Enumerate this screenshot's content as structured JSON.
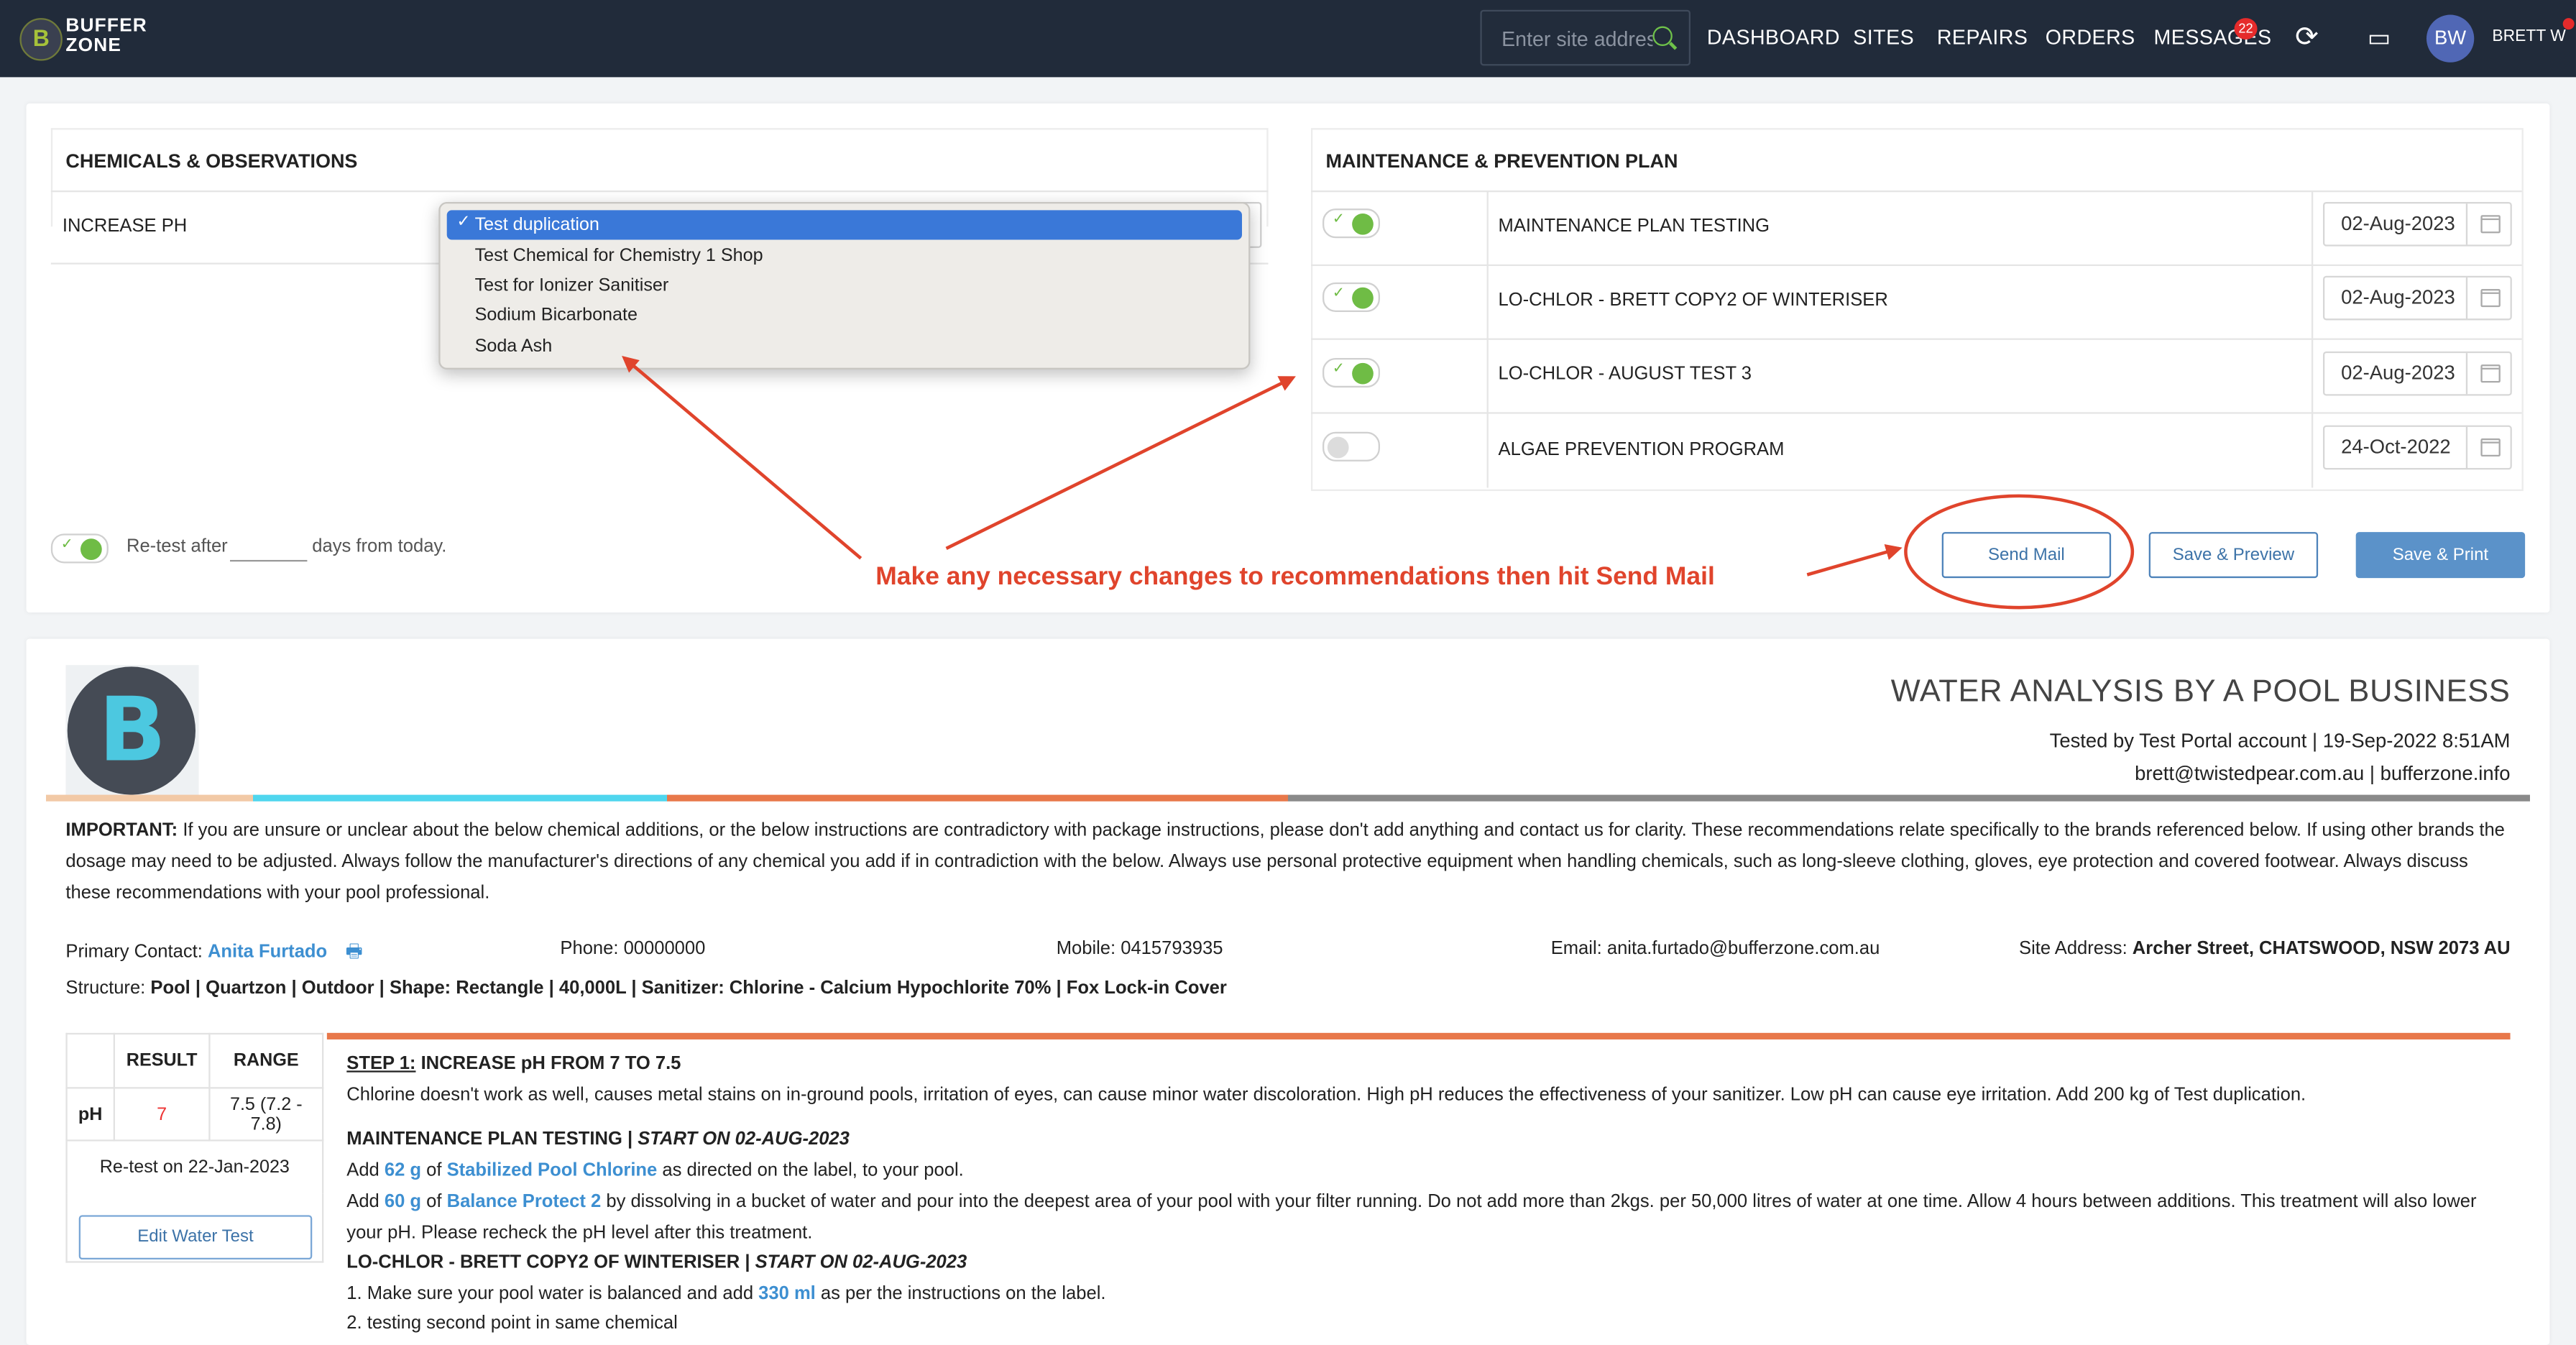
{
  "nav": {
    "logo_line1": "BUFFER",
    "logo_line2": "ZONE",
    "logo_glyph": "B",
    "search_placeholder": "Enter site address",
    "links": [
      "DASHBOARD",
      "SITES",
      "REPAIRS",
      "ORDERS",
      "MESSAGES"
    ],
    "messages_badge": "22",
    "avatar_initials": "BW",
    "user_name": "BRETT W"
  },
  "chem_panel": {
    "title": "CHEMICALS & OBSERVATIONS",
    "row_label": "INCREASE PH",
    "dropdown_options": [
      "Test duplication",
      "Test Chemical for Chemistry 1 Shop",
      "Test for Ionizer Sanitiser",
      "Sodium Bicarbonate",
      "Soda Ash"
    ],
    "selected_index": 0,
    "retest_label": "Re-test after",
    "retest_value": "",
    "retest_suffix": "days from today.",
    "retest_enabled": true
  },
  "maint_panel": {
    "title": "MAINTENANCE & PREVENTION PLAN",
    "rows": [
      {
        "name": "MAINTENANCE PLAN TESTING",
        "date": "02-Aug-2023",
        "enabled": true
      },
      {
        "name": "LO-CHLOR - BRETT COPY2 OF WINTERISER",
        "date": "02-Aug-2023",
        "enabled": true
      },
      {
        "name": "LO-CHLOR - AUGUST TEST 3",
        "date": "02-Aug-2023",
        "enabled": true
      },
      {
        "name": "ALGAE PREVENTION PROGRAM",
        "date": "24-Oct-2022",
        "enabled": false
      }
    ]
  },
  "actions": {
    "send_mail": "Send Mail",
    "save_preview": "Save & Preview",
    "save_print": "Save & Print"
  },
  "annotation": "Make any necessary changes to recommendations then hit Send Mail",
  "report": {
    "title": "WATER ANALYSIS BY A POOL BUSINESS",
    "tested_by": "Tested by Test Portal account | 19-Sep-2022 8:51AM",
    "contact_line": "brett@twistedpear.com.au | bufferzone.info",
    "important_label": "IMPORTANT:",
    "important_text": " If you are unsure or unclear about the below chemical additions, or the below instructions are contradictory with package instructions, please don't add anything and contact us for clarity. These recommendations relate specifically to the brands referenced below. If using other brands the dosage may need to be adjusted. Always follow the manufacturer's directions of any chemical you add if in contradiction with the below. Always use personal protective equipment when handling chemicals, such as long-sleeve clothing, gloves, eye protection and covered footwear. Always discuss these recommendations with your pool professional.",
    "primary_contact_label": "Primary Contact: ",
    "primary_contact": "Anita Furtado",
    "phone": "Phone: 00000000",
    "mobile": "Mobile: 0415793935",
    "email": "Email: anita.furtado@bufferzone.com.au",
    "site_address_label": "Site Address: ",
    "site_address": "Archer Street, CHATSWOOD, NSW 2073 AU",
    "structure_label": "Structure: ",
    "structure": "Pool | Quartzon | Outdoor | Shape: Rectangle | 40,000L | Sanitizer: Chlorine - Calcium Hypochlorite 70% | Fox Lock-in Cover",
    "result_header": "RESULT",
    "range_header": "RANGE",
    "param": "pH",
    "result": "7",
    "range": "7.5 (7.2 - 7.8)",
    "retest_on": "Re-test on 22-Jan-2023",
    "edit_button": "Edit Water Test",
    "step1_label": "STEP 1:",
    "step1_title": " INCREASE pH FROM 7 TO 7.5",
    "step1_text": "Chlorine doesn't work as well, causes metal stains on in-ground pools, irritation of eyes, can cause minor water discoloration. High pH reduces the effectiveness of your sanitizer. Low pH can cause eye irritation. Add 200 kg of Test duplication.",
    "plan1_title": "MAINTENANCE PLAN TESTING | ",
    "plan1_start": "START ON 02-AUG-2023",
    "plan1_line1_a": "Add ",
    "plan1_line1_amt": "62 g",
    "plan1_line1_b": " of ",
    "plan1_line1_prod": "Stabilized Pool Chlorine",
    "plan1_line1_c": " as directed on the label, to your pool.",
    "plan1_line2_a": "Add ",
    "plan1_line2_amt": "60 g",
    "plan1_line2_b": " of ",
    "plan1_line2_prod": "Balance Protect 2",
    "plan1_line2_c": " by dissolving in a bucket of water and pour into the deepest area of your pool with your filter running. Do not add more than 2kgs. per 50,000 litres of water at one time. Allow 4 hours between additions. This treatment will also lower",
    "plan1_line3": "your pH. Please recheck the pH level after this treatment.",
    "plan2_title": "LO-CHLOR - BRETT COPY2 OF WINTERISER | ",
    "plan2_start": "START ON 02-AUG-2023",
    "plan2_line1_a": "1. Make sure your pool water is balanced and add ",
    "plan2_line1_amt": "330 ml",
    "plan2_line1_b": " as per the instructions on the label.",
    "plan2_line2": "2. testing second point in same chemical"
  },
  "colors": {
    "nav_bg": "#212b3a",
    "accent_blue": "#3d73a8",
    "toggle_green": "#6fbc45",
    "annotation_red": "#e0442c",
    "link_blue": "#3d8fd1",
    "band_orange": "#e8784a",
    "band_cyan": "#4fd6ee",
    "band_peach": "#f2c9a6",
    "band_gray": "#8a8a8a"
  }
}
